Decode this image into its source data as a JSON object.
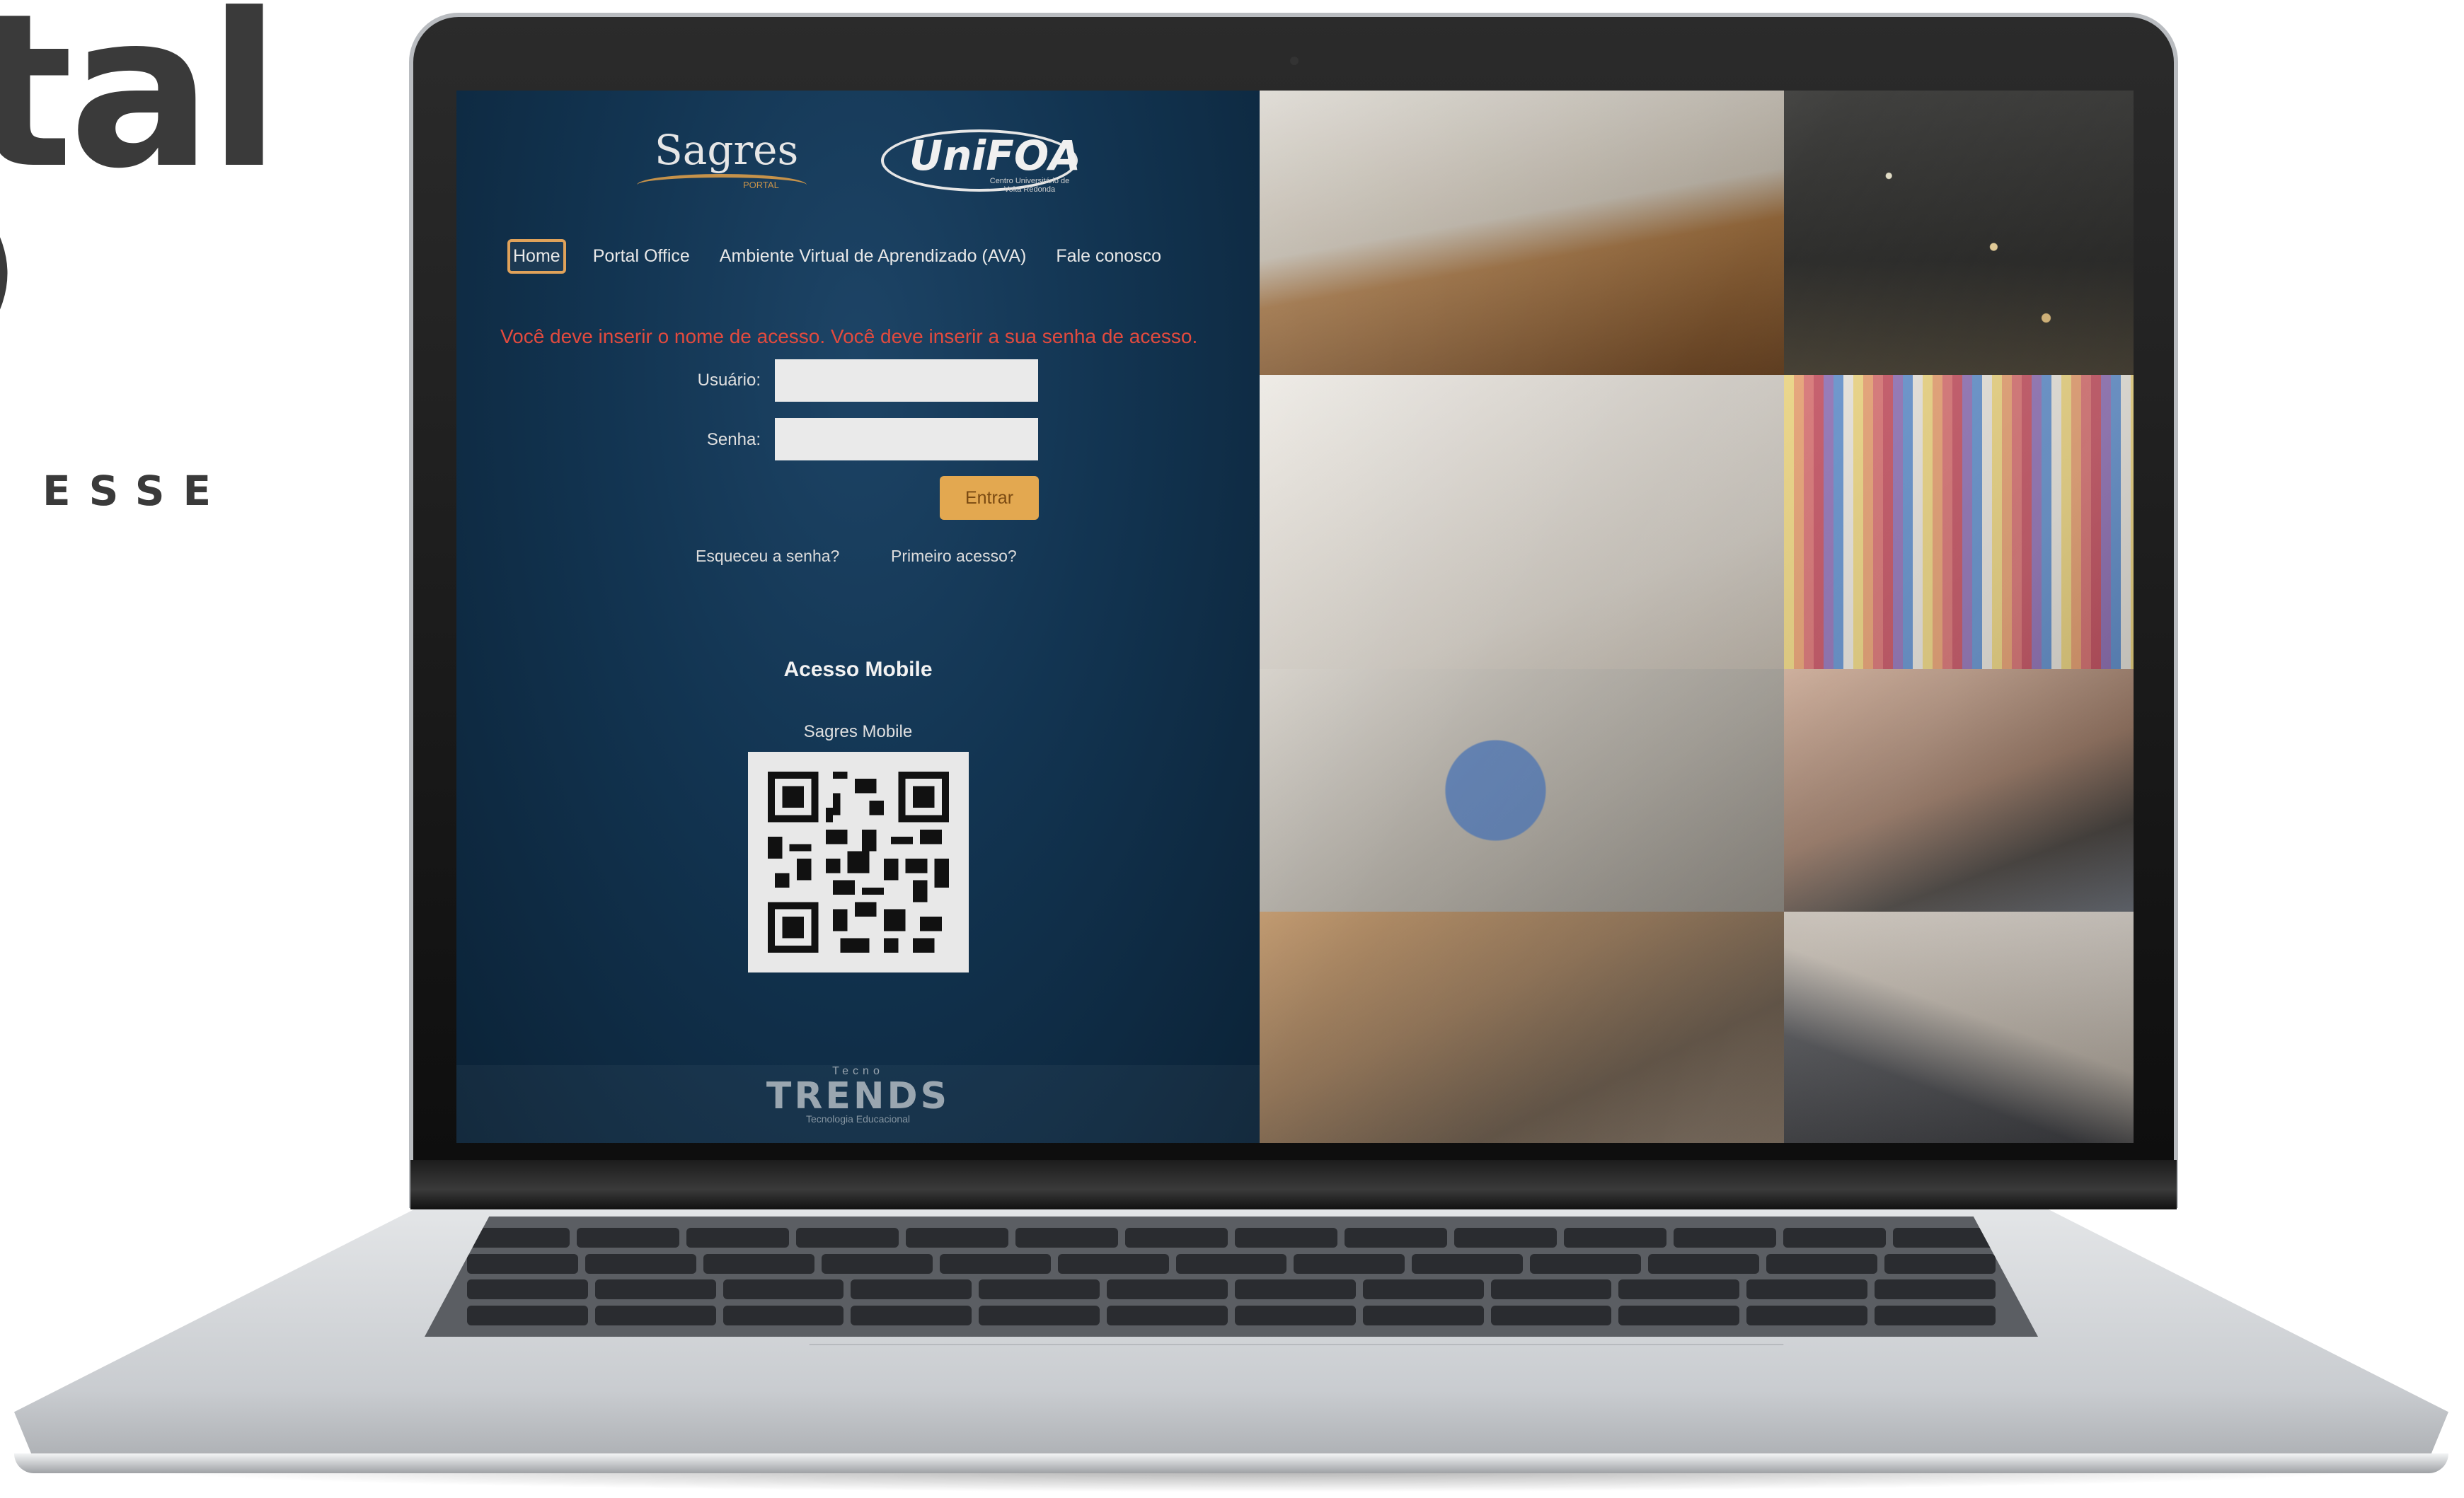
{
  "background": {
    "title_fragment": "tal",
    "paren_fragment": ")",
    "tagline_fragment": "ESSE"
  },
  "login": {
    "logos": {
      "sagres": "Sagres",
      "sagres_sub": "PORTAL",
      "unifoa": "UniFOA",
      "unifoa_sub": "Centro Universitário de Volta Redonda"
    },
    "nav": [
      {
        "label": "Home",
        "active": true
      },
      {
        "label": "Portal Office",
        "active": false
      },
      {
        "label": "Ambiente Virtual de Aprendizado (AVA)",
        "active": false
      },
      {
        "label": "Fale conosco",
        "active": false
      }
    ],
    "error_message": "Você deve inserir o nome de acesso. Você deve inserir a sua senha de acesso.",
    "user_label": "Usuário:",
    "user_value": "",
    "password_label": "Senha:",
    "password_value": "",
    "submit_label": "Entrar",
    "forgot_link": "Esqueceu a senha?",
    "first_access_link": "Primeiro acesso?",
    "mobile": {
      "title": "Acesso Mobile",
      "subtitle": "Sagres Mobile"
    },
    "footer": {
      "brand_top": "Tecno",
      "brand": "TRENDS",
      "tagline": "Tecnologia Educacional"
    }
  },
  "colors": {
    "panel_bg": "#123451",
    "accent": "#e3a850",
    "error": "#e24a3e"
  }
}
